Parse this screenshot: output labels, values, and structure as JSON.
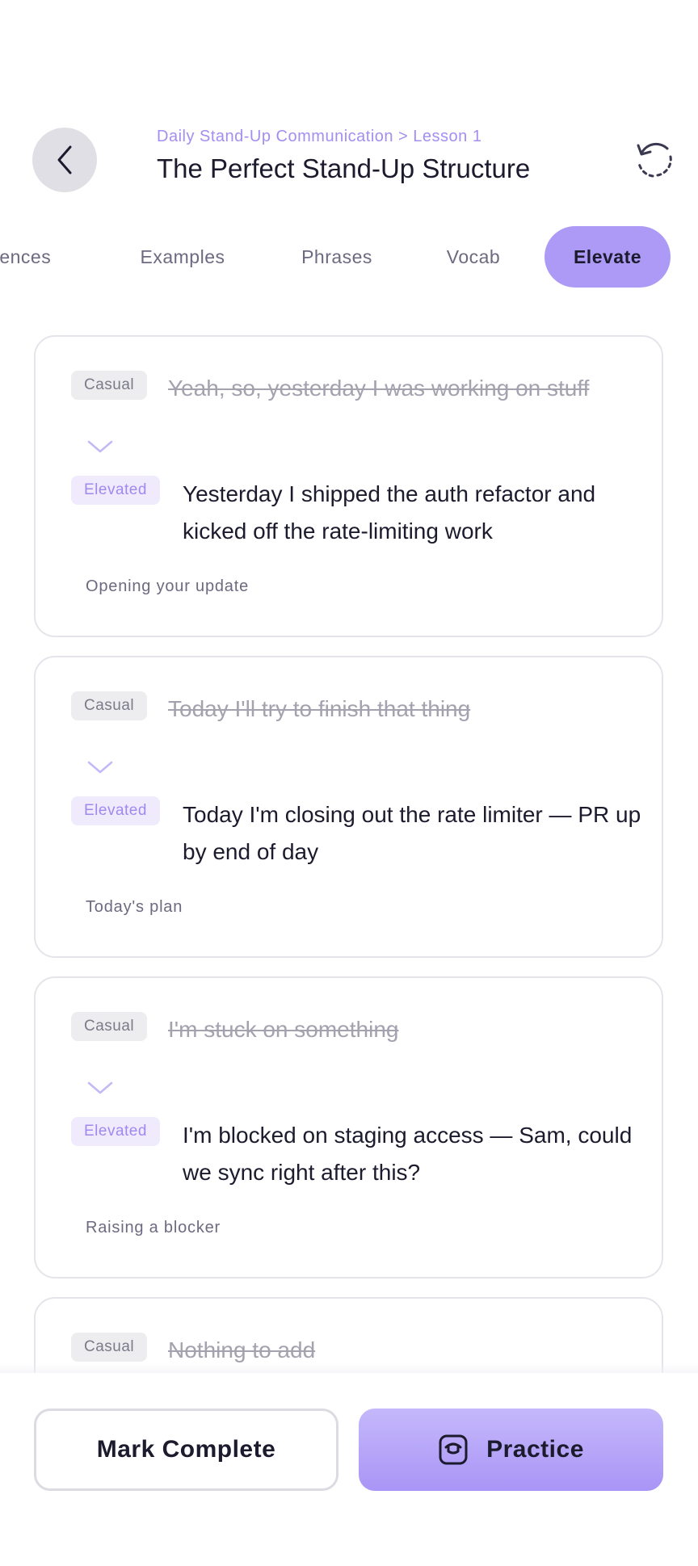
{
  "header": {
    "breadcrumb": "Daily Stand-Up Communication > Lesson 1",
    "title": "The Perfect Stand-Up Structure"
  },
  "tabs": [
    {
      "label": "Sentences",
      "visible_label": "ıces"
    },
    {
      "label": "Examples"
    },
    {
      "label": "Phrases"
    },
    {
      "label": "Vocab"
    },
    {
      "label": "Elevate",
      "active": true
    }
  ],
  "cards": [
    {
      "casual_tag": "Casual",
      "casual": "Yeah, so, yesterday I was working on stuff",
      "elevated_tag": "Elevated",
      "elevated": "Yesterday I shipped the auth refactor and kicked off the rate-limiting work",
      "context": "Opening your update"
    },
    {
      "casual_tag": "Casual",
      "casual": "Today I'll try to finish that thing",
      "elevated_tag": "Elevated",
      "elevated": "Today I'm closing out the rate limiter — PR up by end of day",
      "context": "Today's plan"
    },
    {
      "casual_tag": "Casual",
      "casual": "I'm stuck on something",
      "elevated_tag": "Elevated",
      "elevated": "I'm blocked on staging access — Sam, could we sync right after this?",
      "context": "Raising a blocker"
    },
    {
      "casual_tag": "Casual",
      "casual": "Nothing to add"
    }
  ],
  "footer": {
    "mark_complete": "Mark Complete",
    "practice": "Practice"
  },
  "colors": {
    "accent": "#ad9af7",
    "accent_text": "#a48ef0",
    "title_text": "#1c1b2e"
  },
  "icons": {
    "back": "chevron-left-icon",
    "reset": "restart-icon",
    "divider": "chevron-down-icon",
    "practice": "practice-icon"
  }
}
